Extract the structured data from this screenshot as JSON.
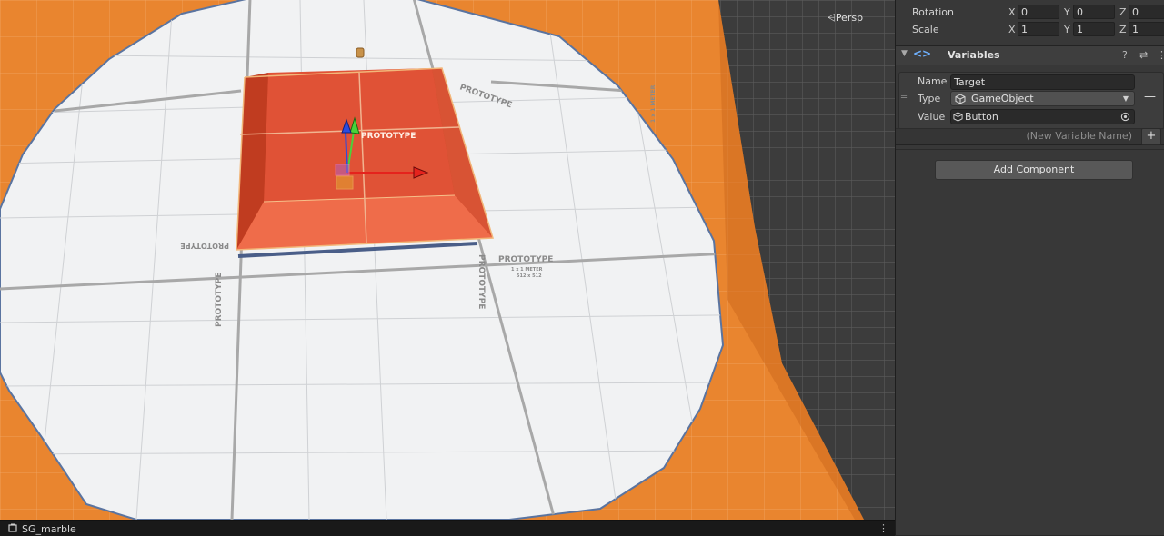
{
  "scene_view": {
    "camera_mode": "Persp",
    "texture_label": "PROTOTYPE",
    "texture_sublabel_1": "1 x 1 METER",
    "texture_sublabel_2": "512 x 512"
  },
  "status_bar": {
    "scene_name": "SG_marble",
    "menu_icon": "kebab-icon"
  },
  "transform": {
    "rotation_label": "Rotation",
    "scale_label": "Scale",
    "axis_x": "X",
    "axis_y": "Y",
    "axis_z": "Z",
    "rotation": {
      "x": "0",
      "y": "0",
      "z": "0"
    },
    "scale": {
      "x": "1",
      "y": "1",
      "z": "1"
    }
  },
  "variables_component": {
    "title": "Variables",
    "icon": "code-brackets-icon",
    "help_icon": "help-icon",
    "settings_icon": "sliders-icon",
    "menu_icon": "kebab-icon",
    "name_label": "Name",
    "name_value": "Target",
    "type_label": "Type",
    "type_value": "GameObject",
    "value_label": "Value",
    "value_value": "Button",
    "remove_label": "—",
    "new_variable_placeholder": "(New Variable Name)",
    "add_label": "+"
  },
  "add_component_label": "Add Component",
  "colors": {
    "scene_orange": "#e9852f",
    "cube_red": "#d7462a",
    "floor_white": "#f1f2f3",
    "panel_bg": "#383838"
  }
}
